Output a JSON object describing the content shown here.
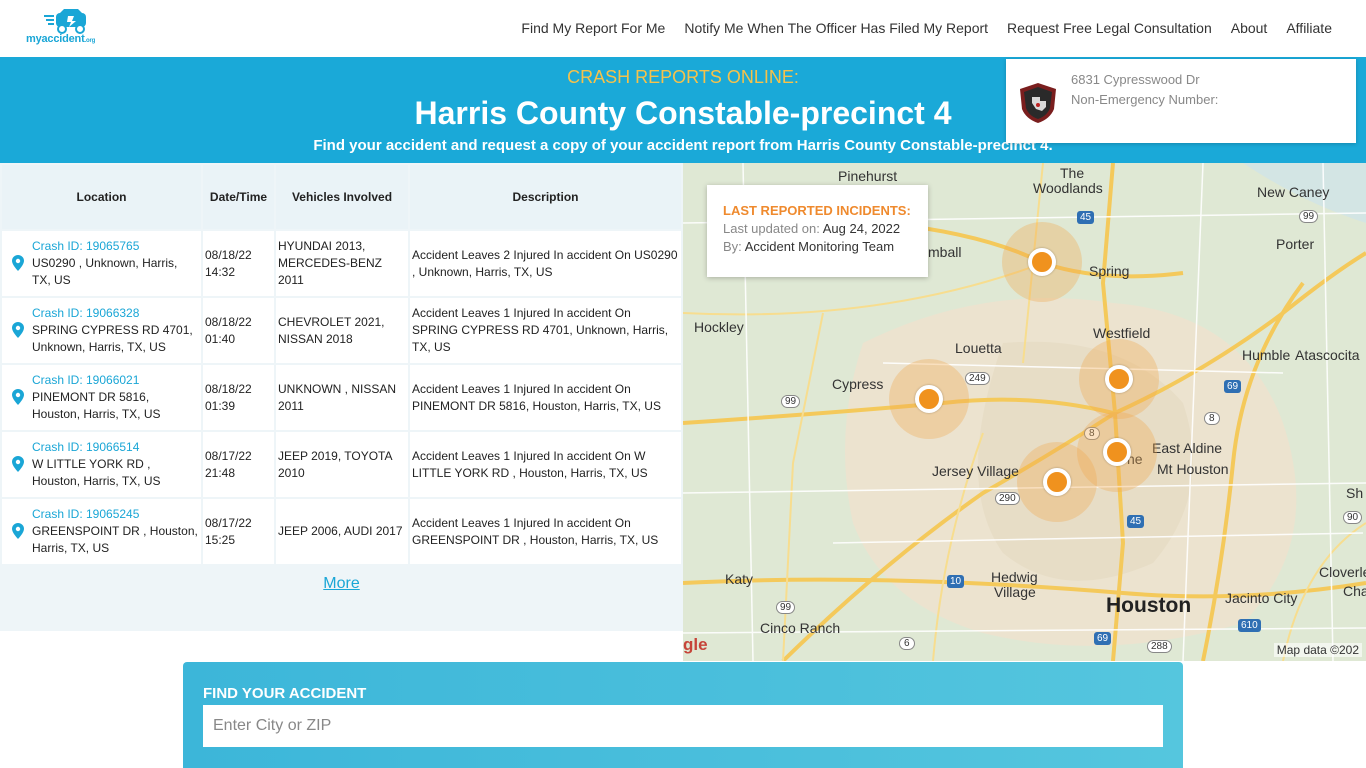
{
  "brand": {
    "logo_text": "myaccident",
    "logo_suffix": ".org"
  },
  "nav": [
    {
      "label": "Find My Report For Me"
    },
    {
      "label": "Notify Me When The Officer Has Filed My Report"
    },
    {
      "label": "Request Free Legal Consultation"
    },
    {
      "label": "About"
    },
    {
      "label": "Affiliate"
    }
  ],
  "hero": {
    "eyebrow": "CRASH REPORTS ONLINE:",
    "title": "Harris County Constable-precinct 4",
    "subtitle": "Find your accident and request a copy of your accident report from Harris County Constable-precinct 4."
  },
  "agency": {
    "address": "6831 Cypresswood Dr",
    "phone_label": "Non-Emergency Number:"
  },
  "table": {
    "headers": [
      "Location",
      "Date/Time",
      "Vehicles Involved",
      "Description"
    ],
    "rows": [
      {
        "crash_id": "Crash ID: 19065765",
        "location": "US0290 , Unknown, Harris, TX, US",
        "date": "08/18/22",
        "time": "14:32",
        "vehicles": "HYUNDAI 2013, MERCEDES-BENZ 2011",
        "description": "Accident Leaves 2 Injured In accident On US0290 , Unknown, Harris, TX, US"
      },
      {
        "crash_id": "Crash ID: 19066328",
        "location": "SPRING CYPRESS RD 4701, Unknown, Harris, TX, US",
        "date": "08/18/22",
        "time": "01:40",
        "vehicles": "CHEVROLET 2021, NISSAN 2018",
        "description": "Accident Leaves 1 Injured In accident On SPRING CYPRESS RD 4701, Unknown, Harris, TX, US"
      },
      {
        "crash_id": "Crash ID: 19066021",
        "location": "PINEMONT DR 5816, Houston, Harris, TX, US",
        "date": "08/18/22",
        "time": "01:39",
        "vehicles": "UNKNOWN , NISSAN 2011",
        "description": "Accident Leaves 1 Injured In accident On PINEMONT DR 5816, Houston, Harris, TX, US"
      },
      {
        "crash_id": "Crash ID: 19066514",
        "location": "W LITTLE YORK RD , Houston, Harris, TX, US",
        "date": "08/17/22",
        "time": "21:48",
        "vehicles": "JEEP 2019, TOYOTA 2010",
        "description": "Accident Leaves 1 Injured In accident On W LITTLE YORK RD , Houston, Harris, TX, US"
      },
      {
        "crash_id": "Crash ID: 19065245",
        "location": "GREENSPOINT DR , Houston, Harris, TX, US",
        "date": "08/17/22",
        "time": "15:25",
        "vehicles": "JEEP 2006, AUDI 2017",
        "description": "Accident Leaves 1 Injured In accident On GREENSPOINT DR , Houston, Harris, TX, US"
      }
    ],
    "more_label": "More"
  },
  "map": {
    "incident_card": {
      "title": "LAST REPORTED INCIDENTS:",
      "updated_label": "Last updated on:",
      "updated_value": "Aug 24, 2022",
      "by_label": "By:",
      "by_value": "Accident Monitoring Team"
    },
    "places": [
      "Pinehurst",
      "The",
      "Woodlands",
      "New Caney",
      "Porter",
      "Spring",
      "Hockley",
      "Westfield",
      "Louetta",
      "Humble",
      "Atascocita",
      "Cypress",
      "East Aldine",
      "Mt Houston",
      "Jersey Village",
      "Katy",
      "Hedwig",
      "Village",
      "Houston",
      "Jacinto City",
      "Cloverleaf",
      "Cinco Ranch",
      "mball",
      "ne",
      "Sh",
      "Cha"
    ],
    "road_shields": [
      "45",
      "99",
      "99",
      "249",
      "69",
      "8",
      "8",
      "290",
      "45",
      "90",
      "10",
      "99",
      "69",
      "6",
      "288",
      "610"
    ],
    "credit": "Map data ©202",
    "google_fragment": "gle",
    "accent_color": "#f0921e"
  },
  "find": {
    "label": "FIND YOUR ACCIDENT",
    "placeholder": "Enter City or ZIP"
  }
}
